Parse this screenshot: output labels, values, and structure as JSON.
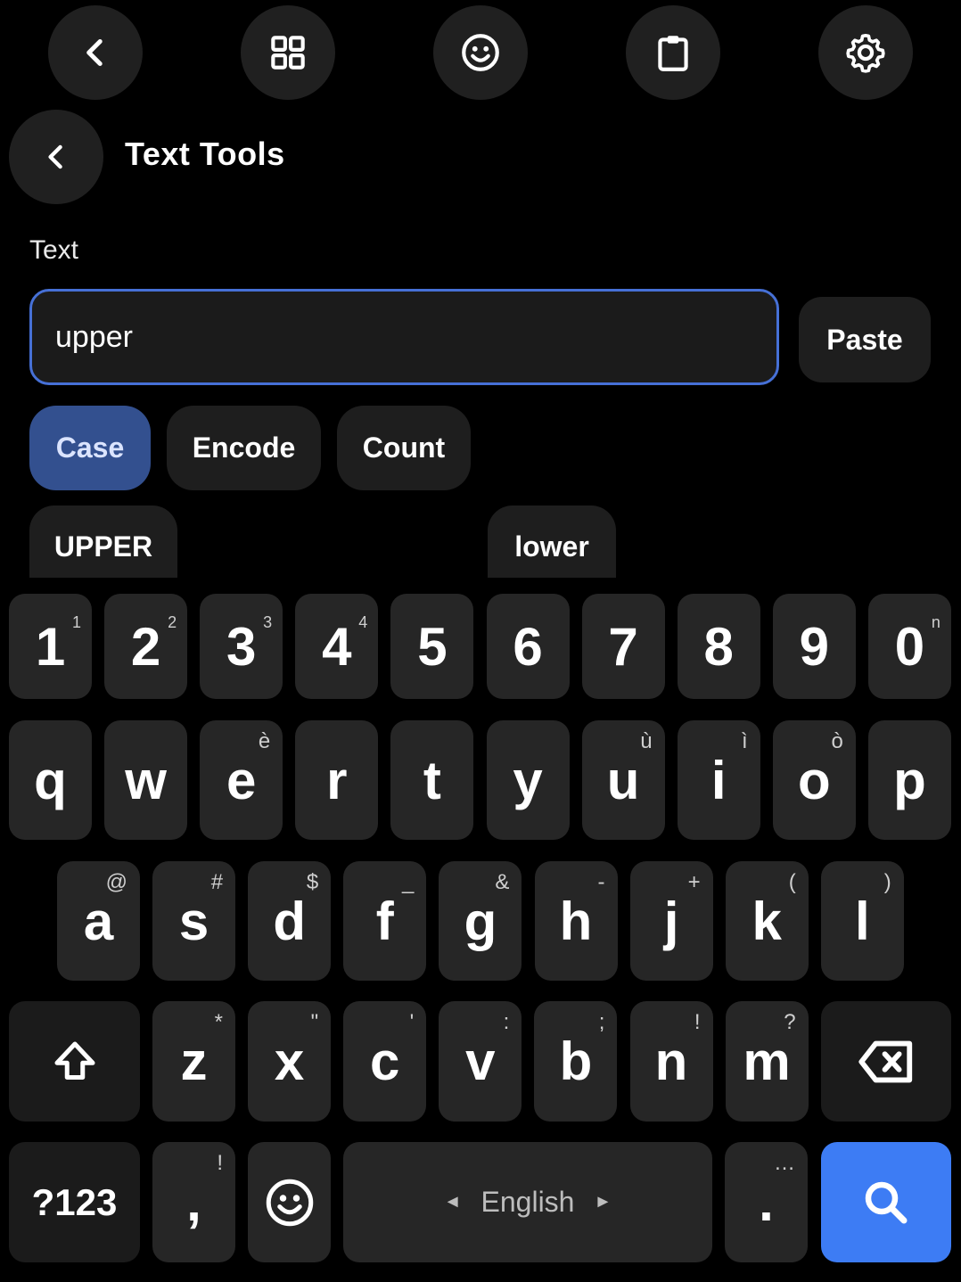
{
  "toolbar": {
    "items": [
      {
        "icon": "chevron-left-icon"
      },
      {
        "icon": "grid-icon"
      },
      {
        "icon": "emoji-icon"
      },
      {
        "icon": "clipboard-icon"
      },
      {
        "icon": "gear-icon"
      }
    ]
  },
  "header": {
    "title": "Text Tools",
    "back_icon": "chevron-left-icon"
  },
  "form": {
    "label": "Text",
    "input_value": "upper",
    "paste_label": "Paste"
  },
  "tabs": [
    {
      "label": "Case",
      "active": true
    },
    {
      "label": "Encode",
      "active": false
    },
    {
      "label": "Count",
      "active": false
    }
  ],
  "results": [
    {
      "label": "UPPER"
    },
    {
      "label": "lower"
    }
  ],
  "keyboard": {
    "number_row": [
      {
        "key": "1",
        "hint": "1"
      },
      {
        "key": "2",
        "hint": "2"
      },
      {
        "key": "3",
        "hint": "3"
      },
      {
        "key": "4",
        "hint": "4"
      },
      {
        "key": "5",
        "hint": ""
      },
      {
        "key": "6",
        "hint": ""
      },
      {
        "key": "7",
        "hint": ""
      },
      {
        "key": "8",
        "hint": ""
      },
      {
        "key": "9",
        "hint": ""
      },
      {
        "key": "0",
        "hint": "n"
      }
    ],
    "row1": [
      {
        "key": "q",
        "hint": ""
      },
      {
        "key": "w",
        "hint": ""
      },
      {
        "key": "e",
        "hint": "è"
      },
      {
        "key": "r",
        "hint": ""
      },
      {
        "key": "t",
        "hint": ""
      },
      {
        "key": "y",
        "hint": ""
      },
      {
        "key": "u",
        "hint": "ù"
      },
      {
        "key": "i",
        "hint": "ì"
      },
      {
        "key": "o",
        "hint": "ò"
      },
      {
        "key": "p",
        "hint": ""
      }
    ],
    "row2": [
      {
        "key": "a",
        "hint": "@"
      },
      {
        "key": "s",
        "hint": "#"
      },
      {
        "key": "d",
        "hint": "$"
      },
      {
        "key": "f",
        "hint": "_"
      },
      {
        "key": "g",
        "hint": "&"
      },
      {
        "key": "h",
        "hint": "-"
      },
      {
        "key": "j",
        "hint": "+"
      },
      {
        "key": "k",
        "hint": "("
      },
      {
        "key": "l",
        "hint": ")"
      }
    ],
    "row3": [
      {
        "key": "z",
        "hint": "*"
      },
      {
        "key": "x",
        "hint": "\""
      },
      {
        "key": "c",
        "hint": "'"
      },
      {
        "key": "v",
        "hint": ":"
      },
      {
        "key": "b",
        "hint": ";"
      },
      {
        "key": "n",
        "hint": "!"
      },
      {
        "key": "m",
        "hint": "?"
      }
    ],
    "shift_icon": "shift-icon",
    "backspace_icon": "backspace-icon",
    "symbols_label": "?123",
    "comma": {
      "key": ",",
      "hint": "!"
    },
    "emoji_icon": "emoji-icon",
    "space_label": "English",
    "period": {
      "key": ".",
      "hint": "…"
    },
    "search_icon": "search-icon",
    "accent_color": "#3d7cf4"
  }
}
